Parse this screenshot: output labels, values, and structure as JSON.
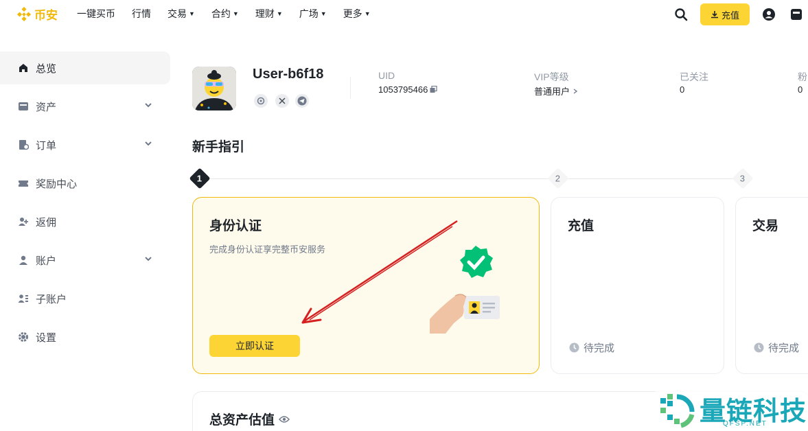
{
  "brand": {
    "name": "币安",
    "color": "#f0b90b"
  },
  "nav": {
    "items": [
      {
        "label": "一键买币",
        "dropdown": false
      },
      {
        "label": "行情",
        "dropdown": false
      },
      {
        "label": "交易",
        "dropdown": true
      },
      {
        "label": "合约",
        "dropdown": true
      },
      {
        "label": "理财",
        "dropdown": true
      },
      {
        "label": "广场",
        "dropdown": true
      },
      {
        "label": "更多",
        "dropdown": true
      }
    ],
    "deposit_label": "充值"
  },
  "sidebar": {
    "items": [
      {
        "label": "总览",
        "icon": "home-icon",
        "active": true
      },
      {
        "label": "资产",
        "icon": "wallet-icon",
        "expandable": true
      },
      {
        "label": "订单",
        "icon": "orders-icon",
        "expandable": true
      },
      {
        "label": "奖励中心",
        "icon": "ticket-icon"
      },
      {
        "label": "返佣",
        "icon": "user-plus-icon"
      },
      {
        "label": "账户",
        "icon": "user-icon",
        "expandable": true
      },
      {
        "label": "子账户",
        "icon": "sub-account-icon"
      },
      {
        "label": "设置",
        "icon": "gear-icon"
      }
    ]
  },
  "profile": {
    "username": "User-b6f18",
    "uid_label": "UID",
    "uid_value": "1053795466",
    "vip_label": "VIP等级",
    "vip_value": "普通用户",
    "following_label": "已关注",
    "following_value": "0",
    "followers_label": "粉",
    "followers_value": "0"
  },
  "guide": {
    "title": "新手指引",
    "steps": [
      "1",
      "2",
      "3"
    ],
    "cards": [
      {
        "title": "身份认证",
        "desc": "完成身份认证享完整币安服务",
        "button": "立即认证"
      },
      {
        "title": "充值",
        "status": "待完成"
      },
      {
        "title": "交易",
        "status": "待完成"
      }
    ]
  },
  "assets": {
    "title": "总资产估值"
  },
  "watermark": {
    "text": "量链科技",
    "sub": "QFSP.NET"
  }
}
